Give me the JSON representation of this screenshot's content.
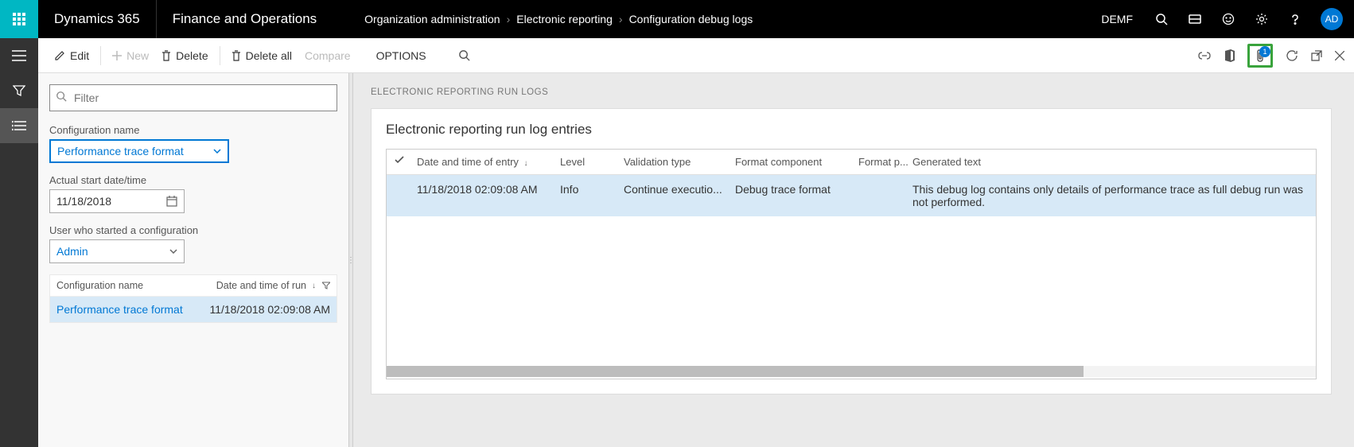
{
  "header": {
    "app": "Dynamics 365",
    "module": "Finance and Operations",
    "breadcrumb": [
      "Organization administration",
      "Electronic reporting",
      "Configuration debug logs"
    ],
    "company": "DEMF",
    "avatar": "AD"
  },
  "actions": {
    "edit": "Edit",
    "new": "New",
    "delete": "Delete",
    "delete_all": "Delete all",
    "compare": "Compare",
    "options": "OPTIONS",
    "attach_count": "1"
  },
  "filter": {
    "placeholder": "Filter",
    "config_label": "Configuration name",
    "config_value": "Performance trace format",
    "date_label": "Actual start date/time",
    "date_value": "11/18/2018",
    "user_label": "User who started a configuration",
    "user_value": "Admin"
  },
  "sidebar_list": {
    "col1": "Configuration name",
    "col2": "Date and time of run",
    "rows": [
      {
        "name": "Performance trace format",
        "date": "11/18/2018 02:09:08 AM"
      }
    ]
  },
  "detail": {
    "section": "Electronic reporting run logs",
    "title": "Electronic reporting run log entries",
    "columns": {
      "date": "Date and time of entry",
      "level": "Level",
      "valid": "Validation type",
      "fmt": "Format component",
      "path": "Format p...",
      "gen": "Generated text"
    },
    "rows": [
      {
        "date": "11/18/2018 02:09:08 AM",
        "level": "Info",
        "valid": "Continue executio...",
        "fmt": "Debug trace format",
        "path": "",
        "gen": "This debug log contains only details of performance trace as full debug run was not performed."
      }
    ]
  }
}
